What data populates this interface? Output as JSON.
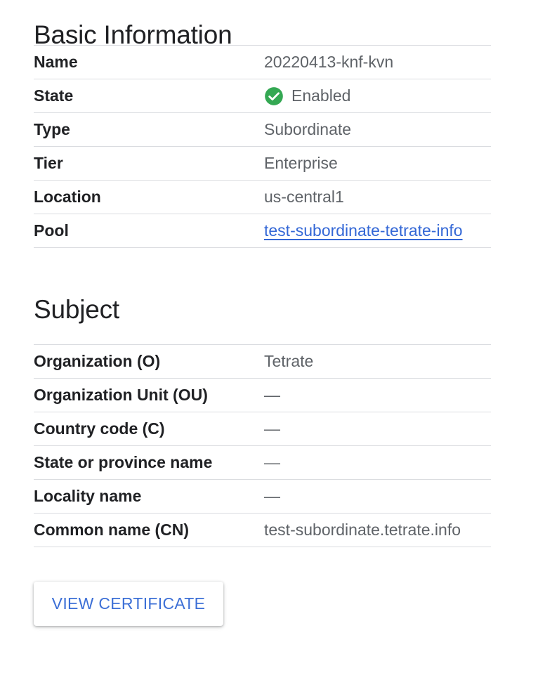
{
  "basic_info": {
    "title": "Basic Information",
    "rows": [
      {
        "label": "Name",
        "value": "20220413-knf-kvn"
      },
      {
        "label": "State",
        "value": "Enabled",
        "icon": "check-circle-icon"
      },
      {
        "label": "Type",
        "value": "Subordinate"
      },
      {
        "label": "Tier",
        "value": "Enterprise"
      },
      {
        "label": "Location",
        "value": "us-central1"
      },
      {
        "label": "Pool",
        "value": "test-subordinate-tetrate-info"
      }
    ]
  },
  "subject": {
    "title": "Subject",
    "rows": [
      {
        "label": "Organization (O)",
        "value": "Tetrate"
      },
      {
        "label": "Organization Unit (OU)",
        "value": "—"
      },
      {
        "label": "Country code (C)",
        "value": "—"
      },
      {
        "label": "State or province name",
        "value": "—"
      },
      {
        "label": "Locality name",
        "value": "—"
      },
      {
        "label": "Common name (CN)",
        "value": "test-subordinate.tetrate.info"
      }
    ]
  },
  "actions": {
    "view_certificate_label": "VIEW CERTIFICATE"
  },
  "colors": {
    "success": "#34a853",
    "link": "#3367d6",
    "divider": "#dadce0"
  }
}
